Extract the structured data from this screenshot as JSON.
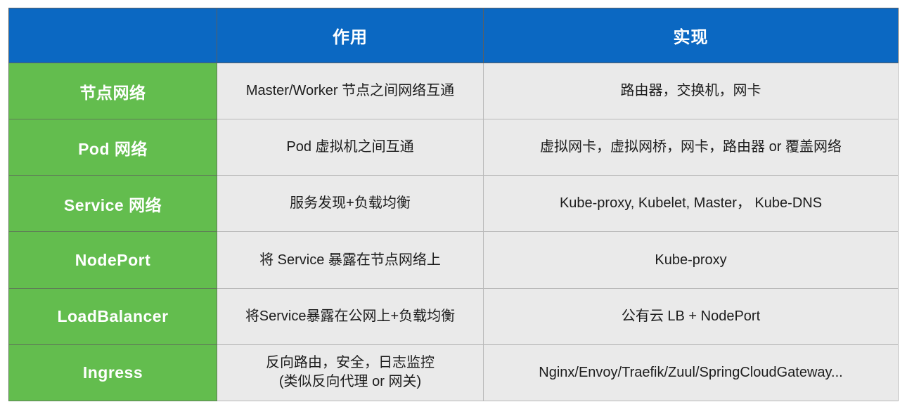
{
  "table": {
    "columns": [
      {
        "key": "name",
        "label": ""
      },
      {
        "key": "role",
        "label": "作用"
      },
      {
        "key": "impl",
        "label": "实现"
      }
    ],
    "header": {
      "col0_label": "",
      "col1_label": "作用",
      "col2_label": "实现"
    },
    "colors": {
      "header_bg": "#0b68c2",
      "header_text": "#ffffff",
      "name_bg": "#63bd4e",
      "name_text": "#ffffff",
      "cell_bg": "#eaeaea",
      "cell_text": "#1c1c1c",
      "border": "#b9b9b9"
    },
    "rows": [
      {
        "name": "节点网络",
        "role": "Master/Worker 节点之间网络互通",
        "impl": "路由器，交换机，网卡"
      },
      {
        "name": "Pod 网络",
        "role": "Pod 虚拟机之间互通",
        "impl": "虚拟网卡，虚拟网桥，网卡，路由器 or 覆盖网络"
      },
      {
        "name": "Service 网络",
        "role": "服务发现+负载均衡",
        "impl": "Kube-proxy, Kubelet, Master， Kube-DNS"
      },
      {
        "name": "NodePort",
        "role": "将 Service 暴露在节点网络上",
        "impl": "Kube-proxy"
      },
      {
        "name": "LoadBalancer",
        "role": "将Service暴露在公网上+负载均衡",
        "impl": "公有云 LB + NodePort"
      },
      {
        "name": "Ingress",
        "role": "反向路由，安全，日志监控\n(类似反向代理 or 网关)",
        "impl": "Nginx/Envoy/Traefik/Zuul/SpringCloudGateway..."
      }
    ]
  }
}
